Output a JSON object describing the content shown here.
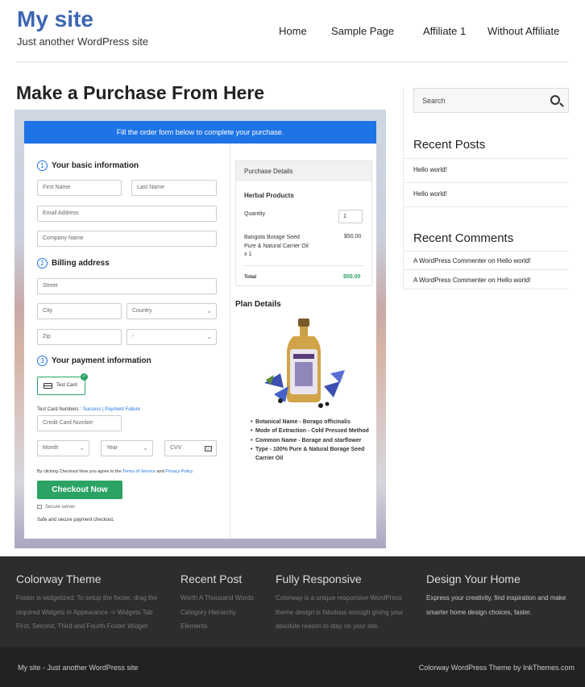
{
  "site": {
    "title": "My site",
    "tagline": "Just another WordPress site"
  },
  "nav": [
    "Home",
    "Sample Page",
    "Affiliate 1",
    "Without Affiliate"
  ],
  "page_title": "Make a Purchase From Here",
  "form": {
    "banner": "Fill the order form below to complete your purchase.",
    "step1": {
      "num": "1",
      "label": "Your basic information"
    },
    "first_name": "First Name",
    "last_name": "Last Name",
    "email": "Email Address",
    "company": "Company Name",
    "step2": {
      "num": "2",
      "label": "Billing address"
    },
    "street": "Street",
    "city": "City",
    "country": "Country",
    "zip": "Zip",
    "state": "-",
    "step3": {
      "num": "3",
      "label": "Your payment information"
    },
    "test_card": "Test Card",
    "test_numbers_label": "Test Card Numbers :",
    "success": "Success",
    "separator": "|",
    "failure": "Payment Failure",
    "card_number": "Credit Card Number",
    "month": "Month",
    "year": "Year",
    "cvv": "CVV",
    "agree_prefix": "By clicking Checkout Now you agree to the",
    "terms": "Terms of Service",
    "and": "and",
    "privacy": "Privacy Policy",
    "checkout_button": "Checkout Now",
    "secure_server": "Secure server",
    "safe_text": "Safe and secure payment checkout."
  },
  "purchase": {
    "heading": "Purchase Details",
    "product_group": "Herbal Products",
    "quantity_label": "Quantity",
    "quantity_value": "1",
    "item_line1": "Bangota Borage Seed",
    "item_line2": "Pure & Natural Carrier Oil",
    "item_line3": "x 1",
    "item_price": "$50.00",
    "total_label": "Total",
    "total_value": "$50.00"
  },
  "plan": {
    "title": "Plan Details",
    "bullets": [
      "Botanical Name - Borago officinalis",
      "Mode of Extraction - Cold Pressed Method",
      "Common Name - Borage and starflower",
      "Type - 100% Pure & Natural Borage Seed Carrier Oil"
    ]
  },
  "sidebar": {
    "search_placeholder": "Search",
    "recent_posts_title": "Recent Posts",
    "recent_posts": [
      "Hello world!",
      "Hello world!"
    ],
    "recent_comments_title": "Recent Comments",
    "recent_comments": [
      {
        "author": "A WordPress Commenter",
        "on": "on",
        "post": "Hello world!"
      },
      {
        "author": "A WordPress Commenter",
        "on": "on",
        "post": "Hello world!"
      }
    ]
  },
  "footer": {
    "col1": {
      "title": "Colorway Theme",
      "lines": [
        "Footer is widgetized. To setup the footer, drag the",
        "required Widgets in Appearance -> Widgets Tab",
        "First, Second, Third and Fourth Footer Widget"
      ]
    },
    "col2": {
      "title": "Recent Post",
      "lines": [
        "Worth A Thousand Words",
        "Category Hierarchy",
        "Elements"
      ]
    },
    "col3": {
      "title": "Fully Responsive",
      "lines": [
        "Colorway is a unique responsive WordPress",
        "theme design is fabulous enough giving your",
        "absolute reason to stay on your site."
      ]
    },
    "col4": {
      "title": "Design Your Home",
      "lines": [
        "Express your creativity, find inspiration and make",
        "smarter home design choices, faster."
      ]
    },
    "bottom_left": "My site - Just another WordPress site",
    "bottom_right": "Colorway WordPress Theme by InkThemes.com"
  },
  "colors": {
    "accent": "#3c65b4",
    "banner": "#1e73e6",
    "success": "#2aa365",
    "footer": "#2d2d2d"
  }
}
